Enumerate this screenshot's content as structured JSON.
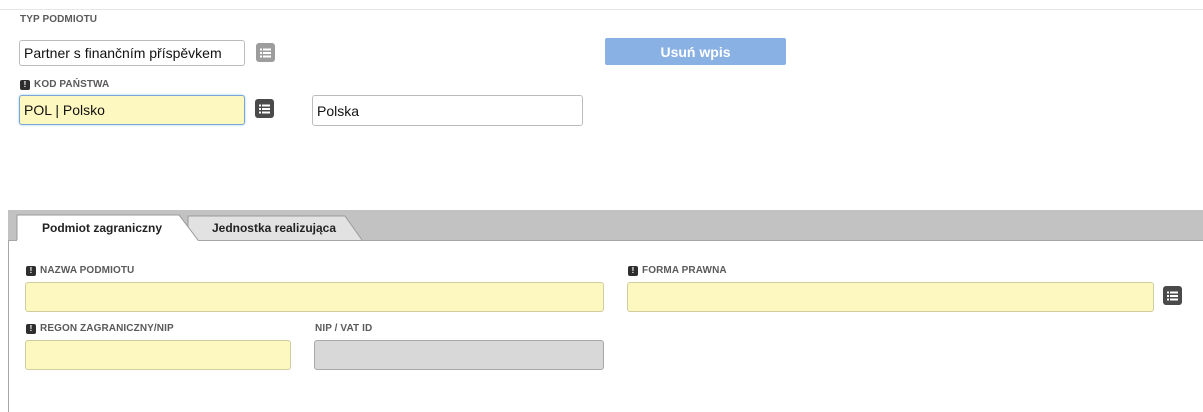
{
  "typ_podmiotu": {
    "label": "TYP PODMIOTU",
    "value": "Partner s finančním příspěvkem"
  },
  "usun_button": {
    "label": "Usuń wpis"
  },
  "kod_panstwa": {
    "label": "KOD PAŃSTWA",
    "value": "POL | Polsko",
    "display_value": "Polska"
  },
  "tabs": [
    {
      "label": "Podmiot zagraniczny",
      "active": true
    },
    {
      "label": "Jednostka realizująca",
      "active": false
    }
  ],
  "form": {
    "nazwa_podmiotu": {
      "label": "NAZWA PODMIOTU",
      "value": ""
    },
    "forma_prawna": {
      "label": "FORMA PRAWNA",
      "value": ""
    },
    "regon": {
      "label": "REGON ZAGRANICZNY/NIP",
      "value": ""
    },
    "nip_vat": {
      "label": "NIP / VAT ID",
      "value": ""
    }
  },
  "colors": {
    "required_field": "#fdf8c0",
    "disabled_field": "#d8d8d8",
    "button_accent": "#8ab1e3",
    "tab_bar": "#c2c2c2"
  },
  "icons": {
    "list": "list-icon",
    "required": "required-marker-icon"
  }
}
